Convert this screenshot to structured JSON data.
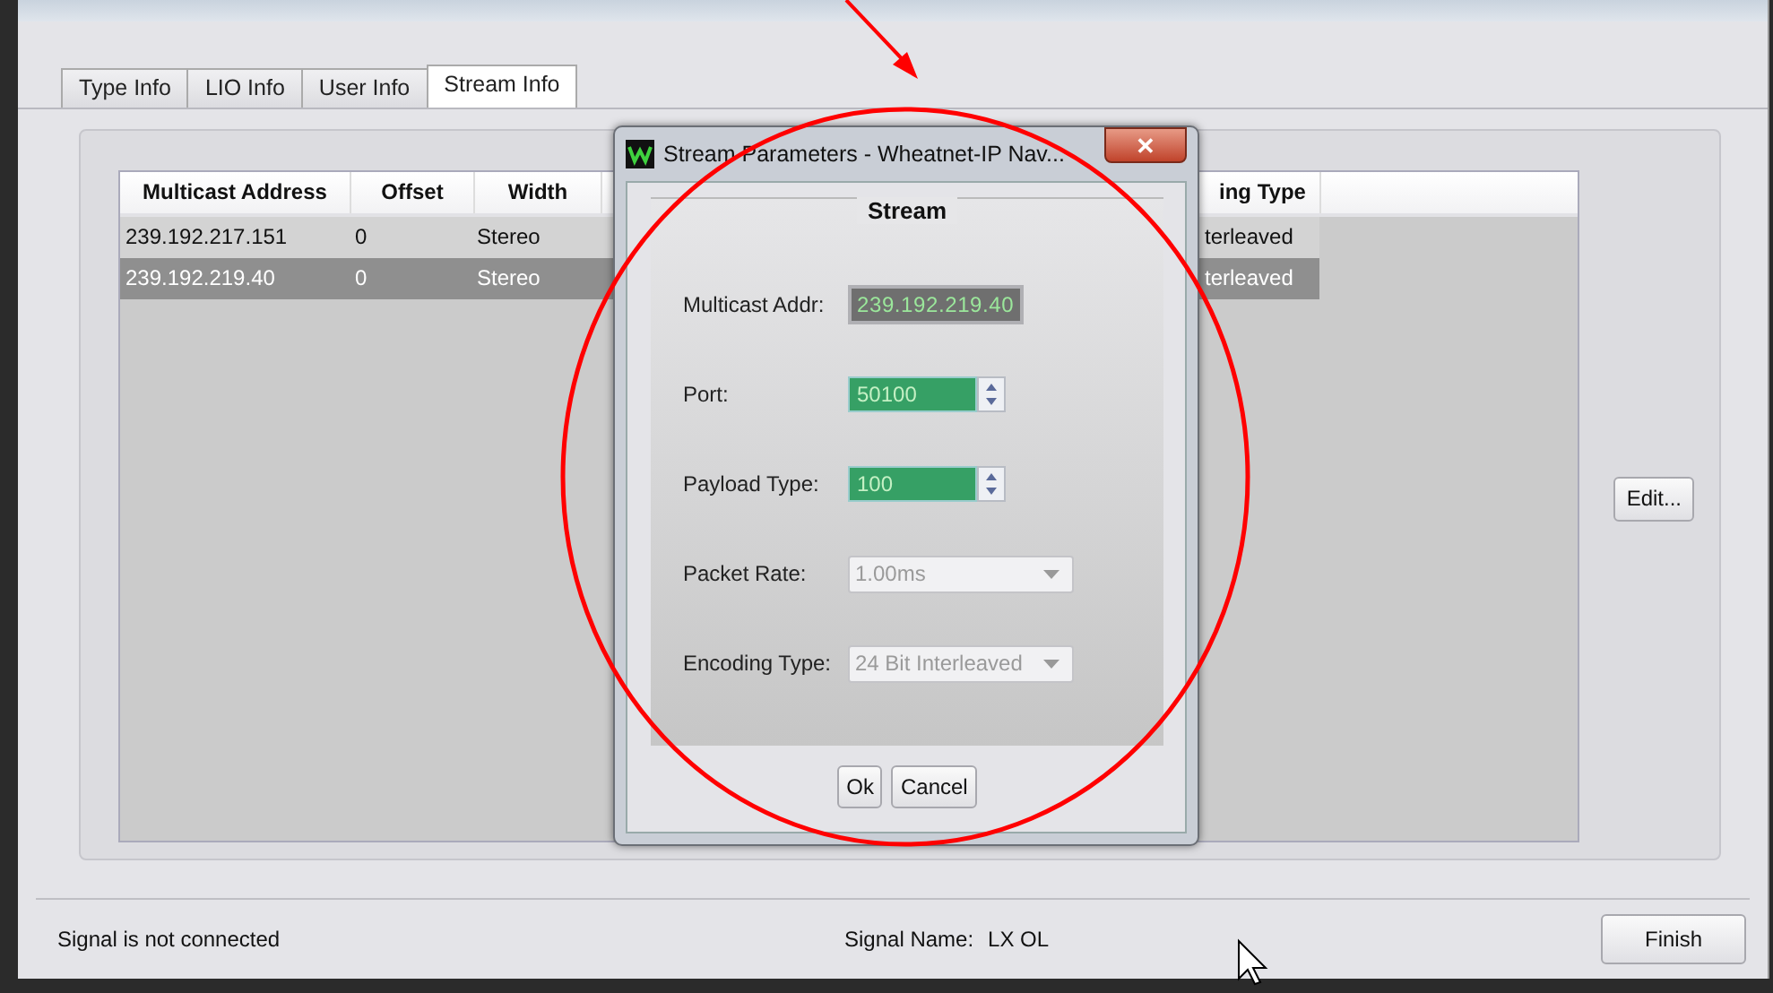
{
  "tabs": [
    {
      "label": "Type Info",
      "selected": false
    },
    {
      "label": "LIO Info",
      "selected": false
    },
    {
      "label": "User Info",
      "selected": false
    },
    {
      "label": "Stream Info",
      "selected": true
    }
  ],
  "table": {
    "columns": [
      "Multicast Address",
      "Offset",
      "Width",
      "ing Type"
    ],
    "rows": [
      {
        "cells": [
          "239.192.217.151",
          "0",
          "Stereo",
          "terleaved"
        ],
        "selected": false
      },
      {
        "cells": [
          "239.192.219.40",
          "0",
          "Stereo",
          "terleaved"
        ],
        "selected": true
      }
    ]
  },
  "edit_button": "Edit...",
  "status_bar": {
    "connection": "Signal is not connected",
    "signal_name_label": "Signal Name:",
    "signal_name": "LX OL",
    "finish_button": "Finish"
  },
  "dialog": {
    "title": "Stream Parameters - Wheatnet-IP Nav...",
    "close": "✕",
    "group_title": "Stream",
    "fields": [
      {
        "label": "Multicast Addr:",
        "kind": "readonly",
        "value": "239.192.219.40"
      },
      {
        "label": "Port:",
        "kind": "spinner",
        "value": "50100"
      },
      {
        "label": "Payload Type:",
        "kind": "spinner",
        "value": "100"
      },
      {
        "label": "Packet Rate:",
        "kind": "dropdown",
        "value": "1.00ms"
      },
      {
        "label": "Encoding Type:",
        "kind": "dropdown",
        "value": "24 Bit Interleaved"
      }
    ],
    "buttons": [
      "Ok",
      "Cancel"
    ]
  }
}
